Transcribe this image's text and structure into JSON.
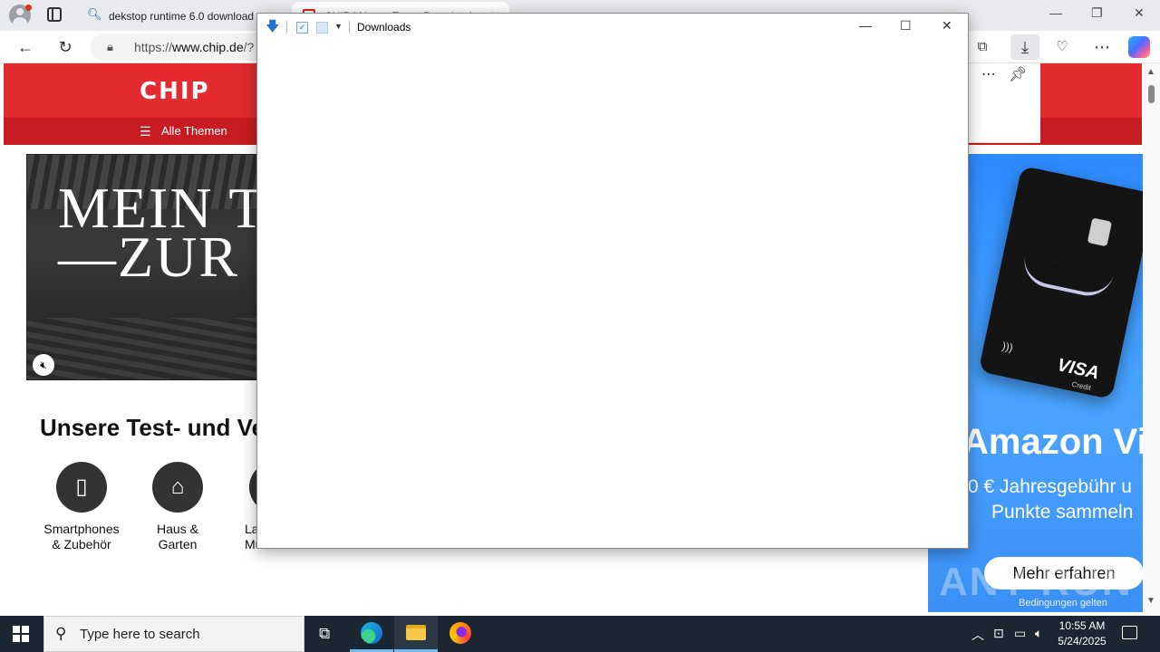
{
  "browser": {
    "tabs": [
      {
        "title": "dekstop runtime 6.0 download"
      },
      {
        "title": "CHIP | News, Tests, Downloads"
      }
    ],
    "address": {
      "url_prefix": "https://",
      "url_host": "www.chip.de",
      "url_rest": "/?"
    }
  },
  "site": {
    "logo": "CHIP",
    "nav_label": "Alle Themen",
    "video_line1": "MEIN T",
    "video_line2": "—ZUR",
    "section_title": "Unsere Test- und Ver",
    "categories": [
      {
        "line1": "Smartphones",
        "line2": "& Zubehör",
        "icon": "smartphone-icon"
      },
      {
        "line1": "Haus &",
        "line2": "Garten",
        "icon": "house-icon"
      },
      {
        "line1": "La",
        "line2": "Mu",
        "icon": "laptop-icon"
      }
    ]
  },
  "ad": {
    "headline": "Amazon Vis",
    "sub1": "0 € Jahresgebühr u",
    "sub2": "Punkte sammeln",
    "cta": "Mehr erfahren",
    "terms": "Bedingungen gelten",
    "card_brand": "VISA",
    "card_type": "Credit"
  },
  "watermark": "ANY RUN",
  "explorer": {
    "title": "Downloads"
  },
  "taskbar": {
    "search_placeholder": "Type here to search",
    "time": "10:55 AM",
    "date": "5/24/2025"
  },
  "colors": {
    "chip_red": "#e32b30",
    "chip_nav": "#c71d22",
    "taskbar": "#1b2633",
    "ad_blue": "#2d8bff"
  }
}
